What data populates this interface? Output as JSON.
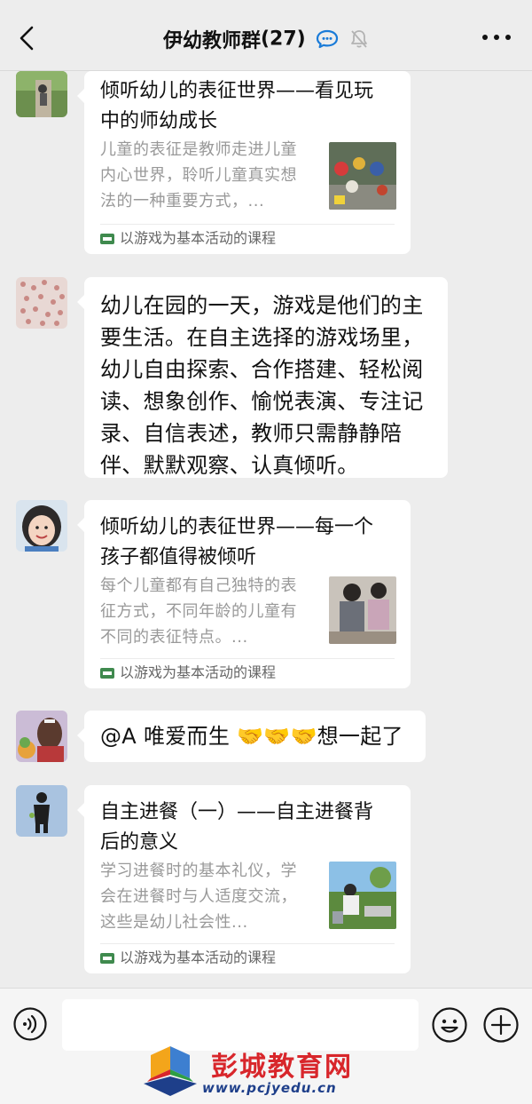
{
  "header": {
    "title": "伊幼教师群",
    "count": "(27)"
  },
  "messages": [
    {
      "type": "card",
      "title": "倾听幼儿的表征世界——看见玩中的师幼成长",
      "description": "儿童的表征是教师走进儿童内心世界，聆听儿童真实想法的一种重要方式，...",
      "source": "以游戏为基本活动的课程"
    },
    {
      "type": "text",
      "text": "幼儿在园的一天，游戏是他们的主要生活。在自主选择的游戏场里，幼儿自由探索、合作搭建、轻松阅读、想象创作、愉悦表演、专注记录、自信表述，教师只需静静陪伴、默默观察、认真倾听。"
    },
    {
      "type": "card",
      "title": "倾听幼儿的表征世界——每一个孩子都值得被倾听",
      "description": "每个儿童都有自己独特的表征方式，不同年龄的儿童有不同的表征特点。...",
      "source": "以游戏为基本活动的课程"
    },
    {
      "type": "text",
      "text": "@A  唯爱而生 🤝🤝🤝想一起了"
    },
    {
      "type": "card",
      "title": "自主进餐（一）——自主进餐背后的意义",
      "description": "学习进餐时的基本礼仪，学会在进餐时与人适度交流，这些是幼儿社会性...",
      "source": "以游戏为基本活动的课程"
    }
  ],
  "input": {
    "value": ""
  },
  "watermark": {
    "name": "彭城教育网",
    "url": "www.pcjyedu.cn"
  },
  "colors": {
    "background": "#ededed",
    "bubble": "#ffffff",
    "secondary_text": "#999999",
    "watermark_red": "#d8262b",
    "watermark_blue": "#1e3f8a"
  },
  "icons": {
    "header": [
      "back-arrow-icon",
      "speech-bubble-icon",
      "mute-bell-icon",
      "more-dots-icon"
    ],
    "input_bar": [
      "voice-icon",
      "emoji-icon",
      "plus-icon"
    ]
  }
}
